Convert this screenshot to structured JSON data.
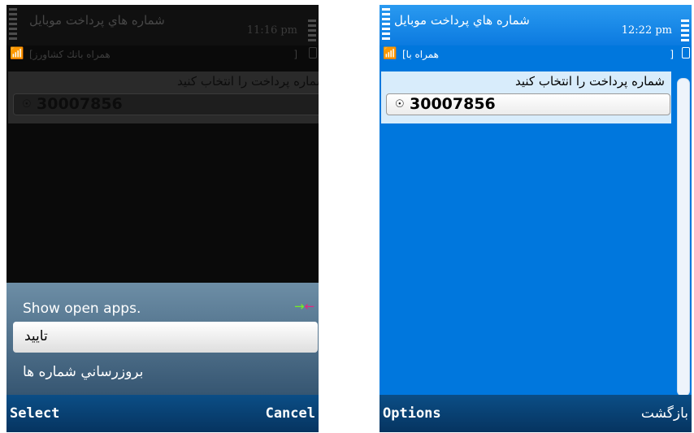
{
  "left_screen": {
    "status": {
      "title": "شماره هاي پرداخت موبايل",
      "time": "11:16 pm",
      "operator": "همراه بانك كشاورز]",
      "bracket": "]"
    },
    "form": {
      "prompt": "شماره پرداخت را انتخاب كنيد",
      "value": "30007856"
    },
    "menu": {
      "items": [
        {
          "label": "Show open apps."
        },
        {
          "label": "تاييد"
        },
        {
          "label": "بروزرساني شماره ها"
        }
      ]
    },
    "softkeys": {
      "left": "Select",
      "right": "Cancel"
    }
  },
  "right_screen": {
    "status": {
      "title": "شماره هاي پرداخت موبايل",
      "time": "12:22 pm",
      "operator": "همراه با]",
      "bracket": "]"
    },
    "form": {
      "prompt": "شماره پرداخت را انتخاب كنيد",
      "value": "30007856"
    },
    "softkeys": {
      "left": "Options",
      "right": "بازگشت"
    }
  },
  "icons": {
    "signal": "signal-strength-icon",
    "battery": "battery-icon",
    "radio": "radio-selected-icon",
    "swap": "task-swap-icon"
  },
  "colors": {
    "screen_blue": "#0077dd",
    "softbar": "#063460",
    "popup": "#355571"
  }
}
